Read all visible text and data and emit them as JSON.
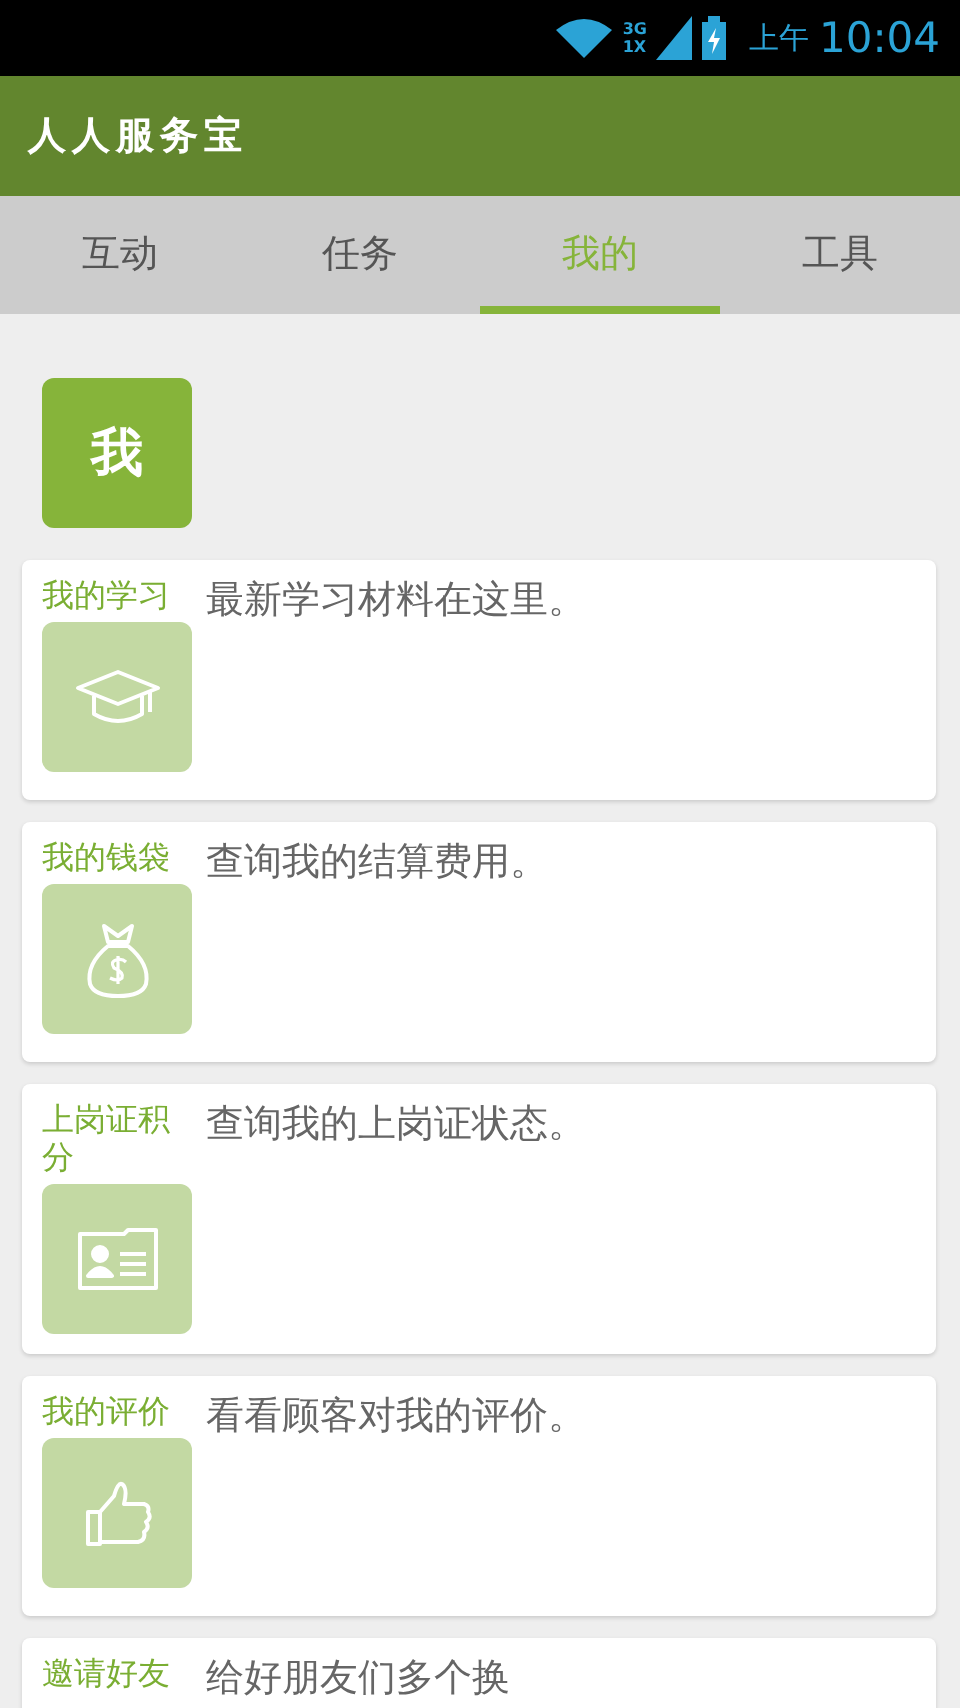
{
  "status_bar": {
    "network": "3G",
    "network2": "1X",
    "time_prefix": "上午",
    "time": "10:04"
  },
  "app_bar": {
    "title": "人人服务宝"
  },
  "tabs": [
    {
      "label": "互动",
      "selected": false
    },
    {
      "label": "任务",
      "selected": false
    },
    {
      "label": "我的",
      "selected": true
    },
    {
      "label": "工具",
      "selected": false
    }
  ],
  "profile": {
    "avatar_text": "我"
  },
  "items": [
    {
      "title": "我的学习",
      "description": "最新学习材料在这里。",
      "kind": "cap"
    },
    {
      "title": "我的钱袋",
      "description": "查询我的结算费用。",
      "kind": "moneybag"
    },
    {
      "title": "上岗证积分",
      "description": "查询我的上岗证状态。",
      "kind": "idcard"
    },
    {
      "title": "我的评价",
      "description": "看看顾客对我的评价。",
      "kind": "thumb"
    },
    {
      "title": "邀请好友",
      "description": "给好朋友们多个换",
      "kind": "none"
    }
  ]
}
